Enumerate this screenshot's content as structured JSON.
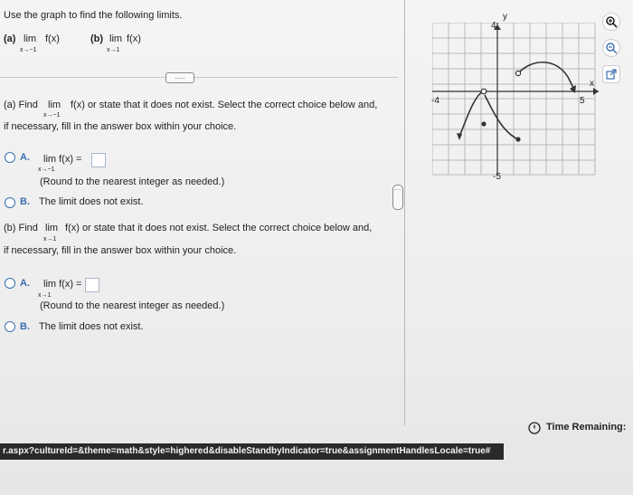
{
  "header": {
    "instruction": "Use the graph to find the following limits.",
    "part_a_label": "(a)",
    "part_a_lim": "lim",
    "part_a_fx": "f(x)",
    "part_a_sub": "x→−1",
    "part_b_label": "(b)",
    "part_b_lim": "lim",
    "part_b_fx": "f(x)",
    "part_b_sub": "x→1",
    "more_button": "....."
  },
  "part_a": {
    "prompt_line1_pre": "(a) Find",
    "lim": "lim",
    "prompt_line1_post": "f(x) or state that it does not exist. Select the correct choice below and,",
    "prompt_sub": "x→−1",
    "prompt_line2": "if necessary, fill in the answer box within your choice.",
    "choice_a_letter": "A.",
    "choice_a_expr": "lim  f(x) =",
    "choice_a_sub": "x→−1",
    "choice_a_note": "(Round to the nearest integer as needed.)",
    "choice_b_letter": "B.",
    "choice_b_text": "The limit does not exist."
  },
  "part_b": {
    "prompt_line1_pre": "(b) Find",
    "lim": "lim",
    "prompt_line1_post": "f(x) or state that it does not exist. Select the correct choice below and,",
    "prompt_sub": "x→1",
    "prompt_line2": "if necessary, fill in the answer box within your choice.",
    "choice_a_letter": "A.",
    "choice_a_expr": "lim  f(x) =",
    "choice_a_sub": "x→1",
    "choice_a_note": "(Round to the nearest integer as needed.)",
    "choice_b_letter": "B.",
    "choice_b_text": "The limit does not exist."
  },
  "graph": {
    "y_label": "y",
    "x_label": "x",
    "y_max_label": "4",
    "y_min_label": "-5",
    "x_min_label": "-4",
    "x_max_label": "5"
  },
  "icons": {
    "zoom_in": "zoom-in-icon",
    "zoom_out": "zoom-out-icon",
    "external": "external-link-icon"
  },
  "drag_handle": "....",
  "status_url": "r.aspx?cultureId=&theme=math&style=highered&disableStandbyIndicator=true&assignmentHandlesLocale=true#",
  "timer_label": "Time Remaining:",
  "colors": {
    "accent": "#3a6fb0",
    "curve": "#333333"
  }
}
